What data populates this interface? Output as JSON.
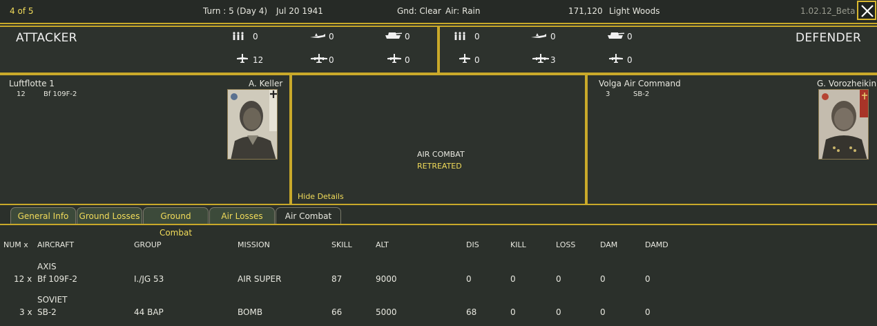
{
  "topbar": {
    "counter": "4 of 5",
    "turn": "Turn : 5 (Day 4)",
    "date": "Jul 20 1941",
    "ground": "Gnd: Clear",
    "air": "Air: Rain",
    "coords": "171,120",
    "terrain": "Light Woods",
    "version": "1.02.12_Beta"
  },
  "attacker": {
    "title": "ATTACKER",
    "counts": {
      "infantry": "0",
      "fighter_top": "0",
      "tank": "0",
      "fighter": "12",
      "bomber": "0",
      "transport": "0"
    }
  },
  "defender": {
    "title": "DEFENDER",
    "counts": {
      "infantry": "0",
      "fighter_top": "0",
      "tank": "0",
      "fighter": "0",
      "bomber": "3",
      "transport": "0"
    }
  },
  "attacker_unit": {
    "hq": "Luftflotte 1",
    "commander": "A. Keller",
    "count": "12",
    "aircraft": "Bf 109F-2"
  },
  "defender_unit": {
    "hq": "Volga Air Command",
    "commander": "G. Vorozheikin",
    "count": "3",
    "aircraft": "SB-2"
  },
  "result": {
    "type": "AIR COMBAT",
    "status": "RETREATED",
    "hide_details": "Hide Details"
  },
  "tabs": [
    "General Info",
    "Ground Losses",
    "Ground Combat",
    "Air Losses",
    "Air Combat"
  ],
  "table": {
    "headers": [
      "NUM x",
      "AIRCRAFT",
      "GROUP",
      "MISSION",
      "SKILL",
      "ALT",
      "DIS",
      "KILL",
      "LOSS",
      "DAM",
      "DAMD"
    ],
    "rows": [
      {
        "side": "AXIS",
        "num": "12 x",
        "aircraft": "Bf 109F-2",
        "group": "I./JG 53",
        "mission": "AIR SUPER",
        "skill": "87",
        "alt": "9000",
        "dis": "0",
        "kill": "0",
        "loss": "0",
        "dam": "0",
        "damd": "0"
      },
      {
        "side": "SOVIET",
        "num": "3 x",
        "aircraft": "SB-2",
        "group": "44 BAP",
        "mission": "BOMB",
        "skill": "66",
        "alt": "5000",
        "dis": "68",
        "kill": "0",
        "loss": "0",
        "dam": "0",
        "damd": "0"
      }
    ]
  },
  "colors": {
    "accent": "#c9a92a",
    "highlight_text": "#f2dc5a",
    "background": "#2b302b"
  }
}
